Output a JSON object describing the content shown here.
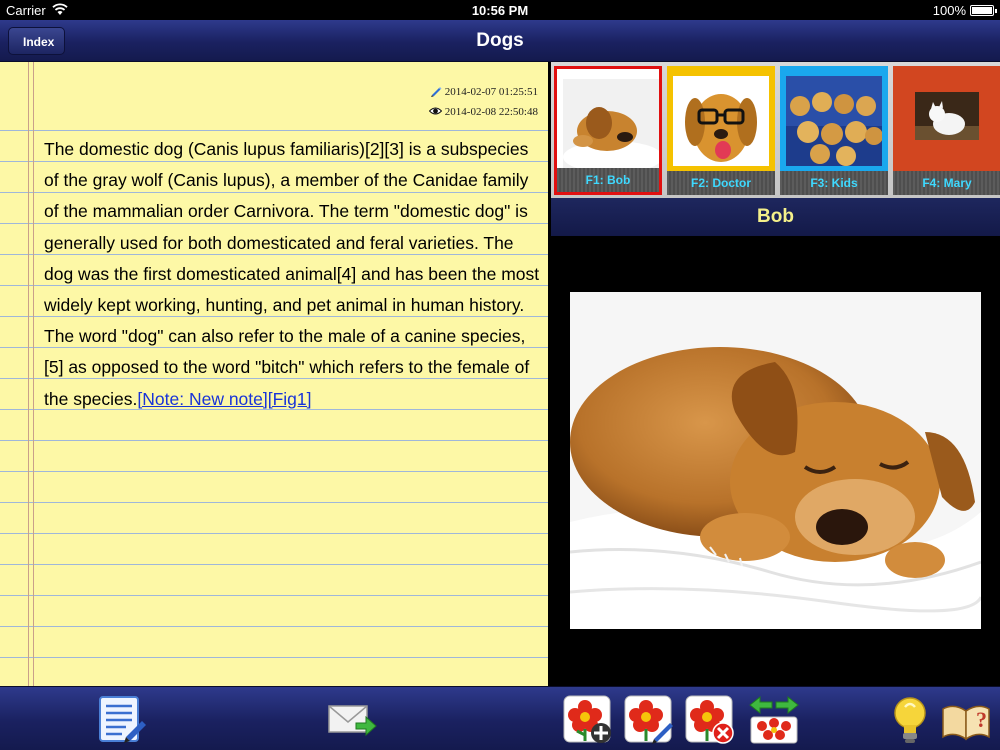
{
  "status_bar": {
    "carrier": "Carrier",
    "time": "10:56 PM",
    "battery": "100%"
  },
  "nav": {
    "back_label": "Index",
    "title": "Dogs"
  },
  "note": {
    "edited": "2014-02-07 01:25:51",
    "viewed": "2014-02-08 22:50:48",
    "text": "The domestic dog (Canis lupus familiaris)[2][3] is a subspecies of the gray wolf (Canis lupus), a member of the Canidae family of the mammalian order Carnivora. The term \"domestic dog\" is generally used for both domesticated and feral varieties. The dog was the first domesticated animal[4] and has been the most widely kept working, hunting, and pet animal in human history. The word \"dog\" can also refer to the male of a canine species,[5] as opposed to the word \"bitch\" which refers to the female of the species.",
    "link": "[Note: New note][Fig1]"
  },
  "figures": {
    "items": [
      {
        "label": "F1: Bob",
        "frame": "#ffffff",
        "selected": true
      },
      {
        "label": "F2: Doctor",
        "frame": "#f5c200",
        "selected": false
      },
      {
        "label": "F3: Kids",
        "frame": "#1aa8ee",
        "selected": false
      },
      {
        "label": "F4: Mary",
        "frame": "#d24620",
        "selected": false
      }
    ],
    "selected_title": "Bob"
  },
  "toolbar": {
    "icons": [
      "edit-note-icon",
      "email-icon",
      "add-figure-icon",
      "edit-figure-icon",
      "delete-figure-icon",
      "reorder-figures-icon",
      "tips-icon",
      "help-book-icon"
    ]
  }
}
